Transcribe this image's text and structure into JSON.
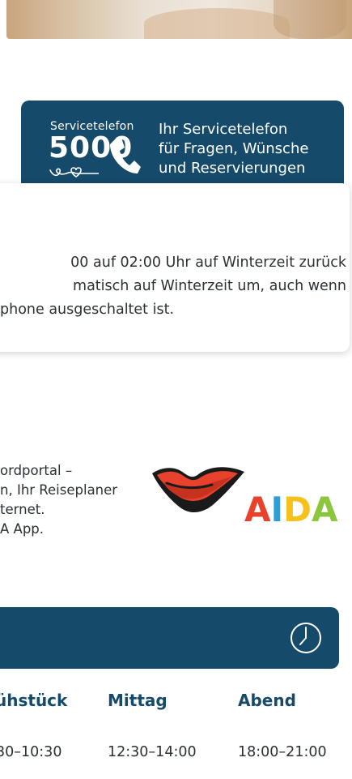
{
  "service": {
    "label_small": "Servicetelefon",
    "number": "5000",
    "line1": "Ihr Servicetelefon",
    "line2": "für Fragen, Wünsche",
    "line3": "und Reservierungen",
    "icons": [
      "heart-loop-icon",
      "phone-icon"
    ],
    "color": "#154a6b"
  },
  "info": {
    "line1": "00 auf 02:00 Uhr auf Winterzeit zurück",
    "line2": "matisch auf Winterzeit um, auch wenn",
    "line3": "phone ausgeschaltet ist."
  },
  "promo": {
    "line1": "ordportal –",
    "line2": "n, Ihr Reiseplaner",
    "line3": "ternet.",
    "line4": "A App.",
    "logo_text": "AIDA",
    "logo_colors": [
      "#e8412c",
      "#2a9fd8",
      "#f6c11b",
      "#8cc63f"
    ]
  },
  "times": {
    "icon": "clock-icon",
    "columns": [
      {
        "label": "ühstück",
        "value": "30–10:30"
      },
      {
        "label": "Mittag",
        "value": "12:30–14:00"
      },
      {
        "label": "Abend",
        "value": "18:00–21:00"
      }
    ]
  }
}
